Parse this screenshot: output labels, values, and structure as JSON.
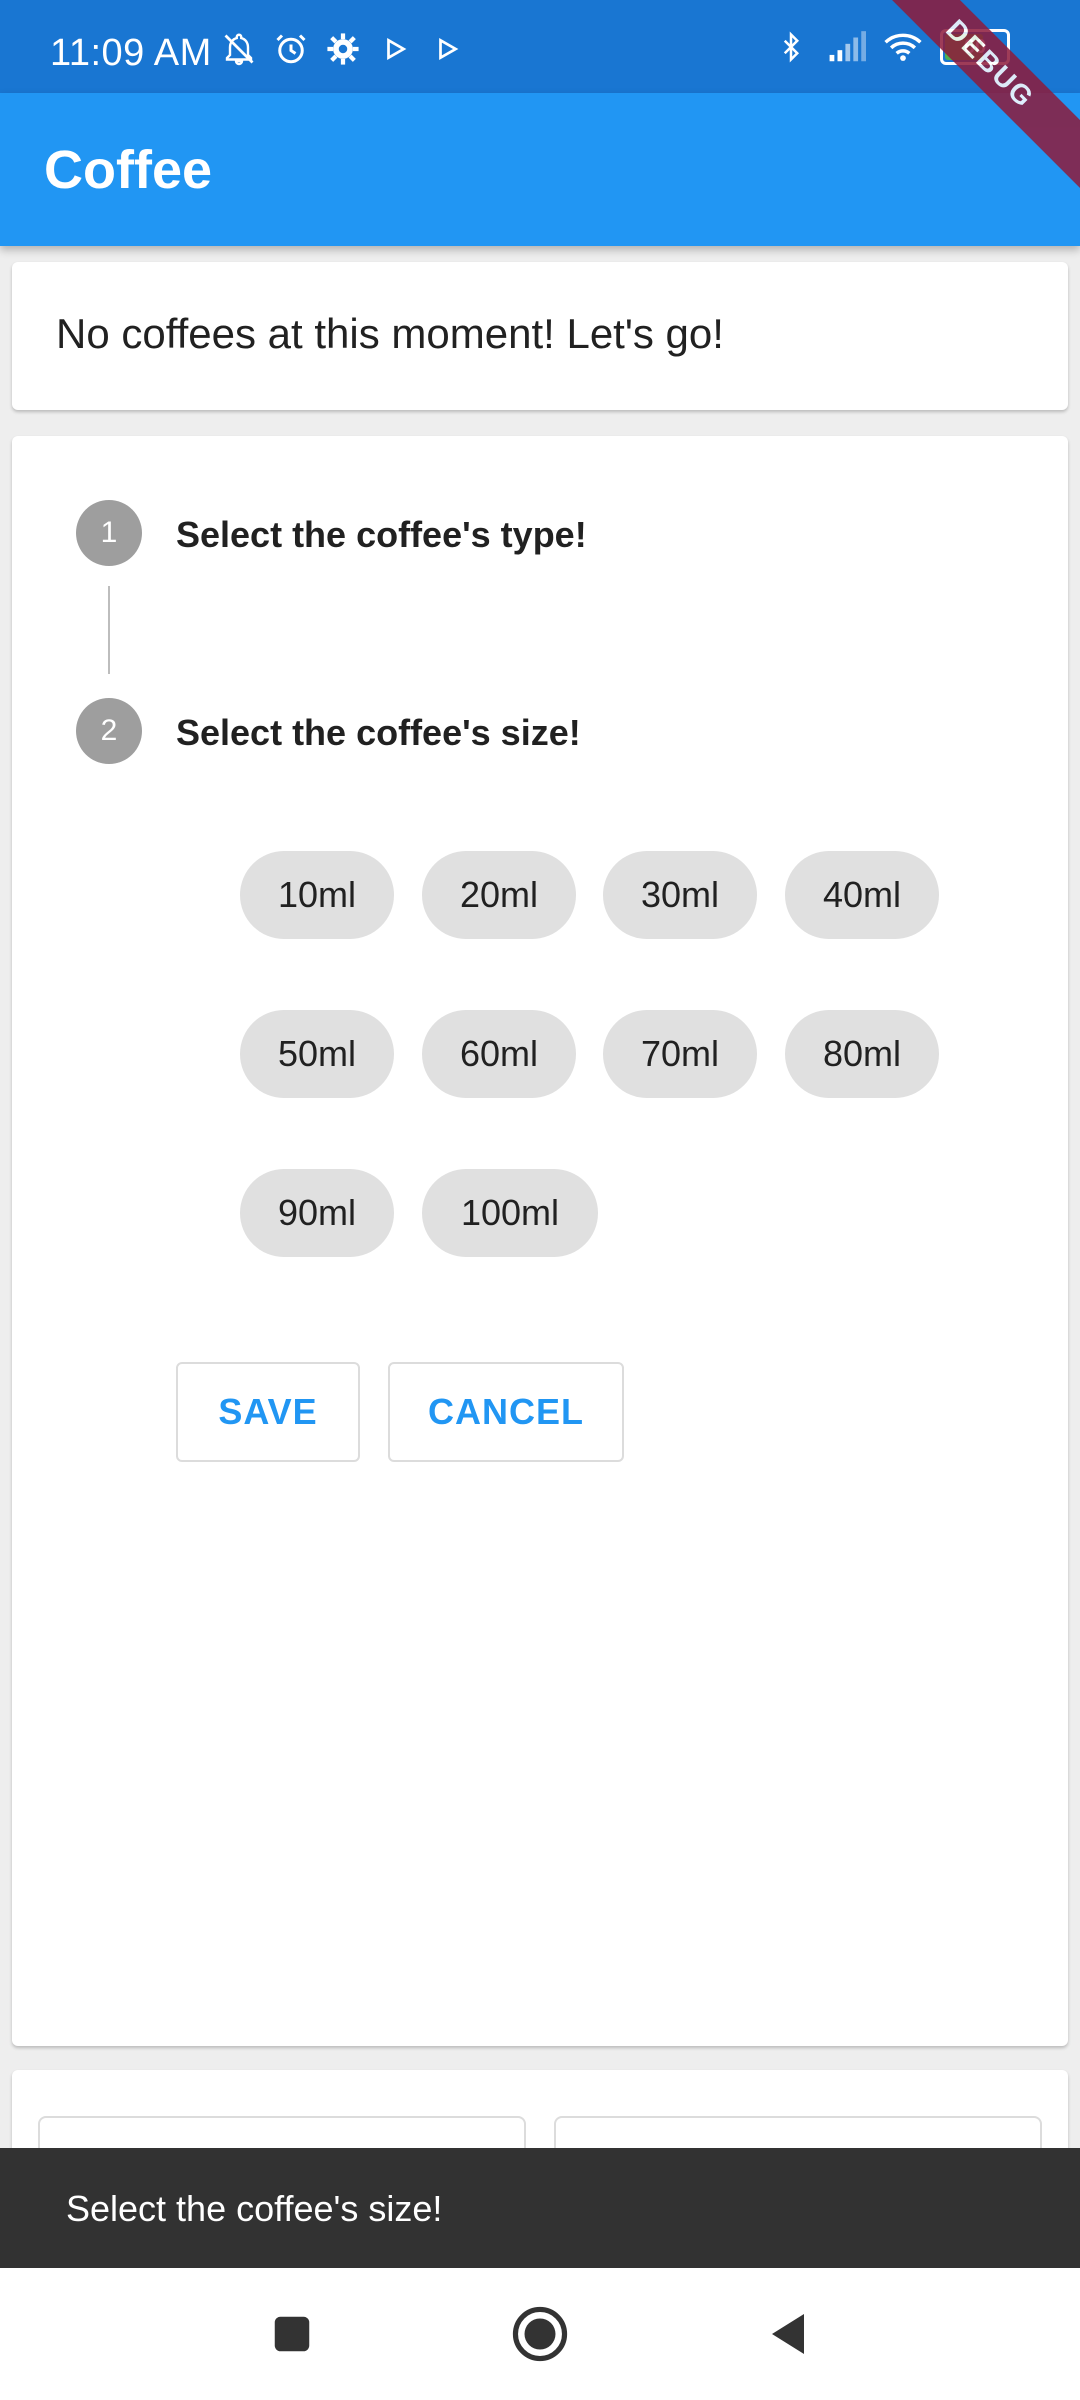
{
  "status_bar": {
    "time": "11:09 AM",
    "battery": "60",
    "icons_left": [
      "notifications-off-icon",
      "alarm-icon",
      "settings-icon",
      "play-icon",
      "play-icon"
    ],
    "icons_right": [
      "bluetooth-icon",
      "signal-icon",
      "wifi-icon",
      "battery-icon"
    ]
  },
  "debug_banner": "DEBUG",
  "app_bar": {
    "title": "Coffee"
  },
  "summary": {
    "message": "No coffees at this moment! Let's go!"
  },
  "stepper": {
    "steps": [
      {
        "number": "1",
        "title": "Select the coffee's type!"
      },
      {
        "number": "2",
        "title": "Select the coffee's size!"
      }
    ],
    "sizes": [
      "10ml",
      "20ml",
      "30ml",
      "40ml",
      "50ml",
      "60ml",
      "70ml",
      "80ml",
      "90ml",
      "100ml"
    ],
    "actions": {
      "save": "SAVE",
      "cancel": "CANCEL"
    }
  },
  "snackbar": {
    "message": "Select the coffee's size!"
  },
  "nav_bar": {
    "buttons": [
      "recents-icon",
      "home-icon",
      "back-icon"
    ]
  },
  "colors": {
    "status_bar": "#1976d2",
    "app_bar": "#2196f3",
    "accent": "#2196f3",
    "step_circle": "#9e9e9e",
    "chip": "#e0e0e0",
    "snackbar": "#323232"
  }
}
